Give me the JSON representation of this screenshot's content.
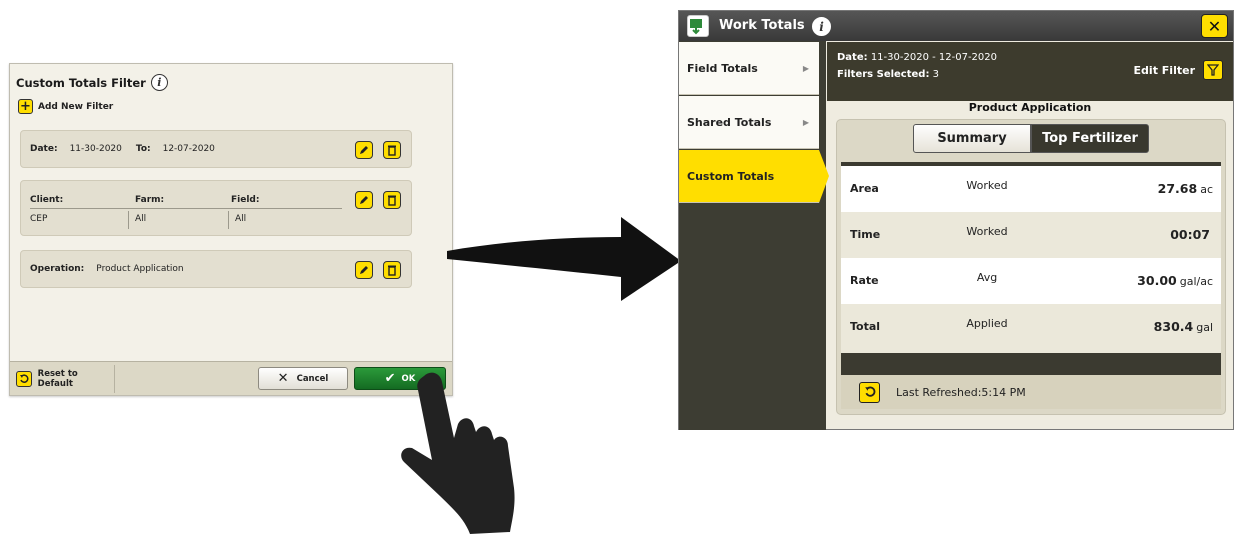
{
  "filter_dialog": {
    "title": "Custom Totals Filter",
    "add_label": "Add New Filter",
    "date_card": {
      "date_label": "Date:",
      "date_from": "11-30-2020",
      "to_label": "To:",
      "date_to": "12-07-2020"
    },
    "client_card": {
      "headers": [
        "Client:",
        "Farm:",
        "Field:"
      ],
      "values": [
        "CEP",
        "All",
        "All"
      ]
    },
    "operation_card": {
      "label": "Operation:",
      "value": "Product Application"
    },
    "reset_label": "Reset to Default",
    "cancel_label": "Cancel",
    "ok_label": "OK"
  },
  "work_totals": {
    "title": "Work Totals",
    "nav": [
      "Field Totals",
      "Shared Totals",
      "Custom Totals"
    ],
    "active_nav": "Custom Totals",
    "filter_info": {
      "date_label": "Date:",
      "date_value": "11-30-2020 - 12-07-2020",
      "filters_label": "Filters Selected:",
      "filters_value": "3",
      "edit_label": "Edit Filter"
    },
    "section_title": "Product Application",
    "tabs": [
      "Summary",
      "Top Fertilizer"
    ],
    "active_tab": "Top Fertilizer",
    "rows": [
      {
        "name": "Area",
        "desc": "Worked",
        "value": "27.68",
        "unit": "ac"
      },
      {
        "name": "Time",
        "desc": "Worked",
        "value": "00:07",
        "unit": ""
      },
      {
        "name": "Rate",
        "desc": "Avg",
        "value": "30.00",
        "unit": "gal/ac"
      },
      {
        "name": "Total",
        "desc": "Applied",
        "value": "830.4",
        "unit": "gal"
      }
    ],
    "refresh_text": "Last Refreshed:5:14 PM"
  },
  "colors": {
    "accent_yellow": "#ffde00",
    "ok_green": "#1f8a2f",
    "header_dark": "#3d3b2d"
  },
  "icons": [
    "info-icon",
    "plus-icon",
    "pencil-icon",
    "trash-icon",
    "undo-icon",
    "close-icon",
    "check-icon",
    "funnel-icon",
    "arrow-icon",
    "hand-pointer-icon",
    "app-icon"
  ]
}
